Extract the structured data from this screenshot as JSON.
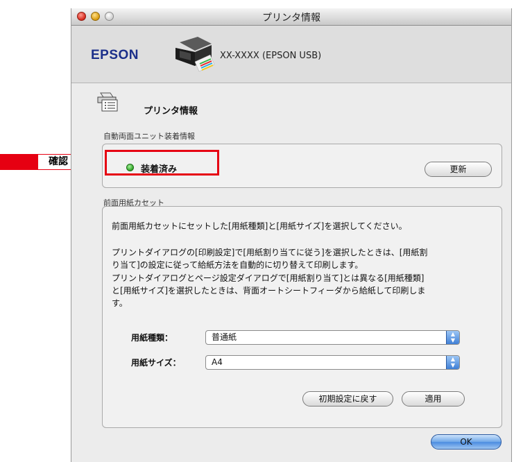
{
  "window": {
    "title": "プリンタ情報"
  },
  "header": {
    "brand": "EPSON",
    "model": "XX-XXXX (EPSON USB)"
  },
  "section": {
    "title": "プリンタ情報"
  },
  "duplex": {
    "label": "自動両面ユニット装着情報",
    "status": "装着済み",
    "status_color": "#2ea326",
    "refresh_label": "更新"
  },
  "annotation": {
    "label": "確認",
    "color": "#e60012"
  },
  "cassette": {
    "label": "前面用紙カセット",
    "line1": "前面用紙カセットにセットした[用紙種類]と[用紙サイズ]を選択してください。",
    "line2": "プリントダイアログの[印刷設定]で[用紙割り当てに従う]を選択したときは、[用紙割",
    "line3": "り当て]の設定に従って給紙方法を自動的に切り替えて印刷します。",
    "line4": "プリントダイアログとページ設定ダイアログで[用紙割り当て]とは異なる[用紙種類]",
    "line5": "と[用紙サイズ]を選択したときは、背面オートシートフィーダから給紙して印刷しま",
    "line6": "す。",
    "paper_type_label": "用紙種類：",
    "paper_type_value": "普通紙",
    "paper_size_label": "用紙サイズ：",
    "paper_size_value": "A4",
    "reset_label": "初期設定に戻す",
    "apply_label": "適用"
  },
  "footer": {
    "ok_label": "OK"
  },
  "icons": {
    "close": "close-icon",
    "minimize": "minimize-icon",
    "zoom": "zoom-icon",
    "printer": "printer-icon",
    "printer_info": "printer-info-icon",
    "select_arrows": "select-arrows-icon"
  }
}
